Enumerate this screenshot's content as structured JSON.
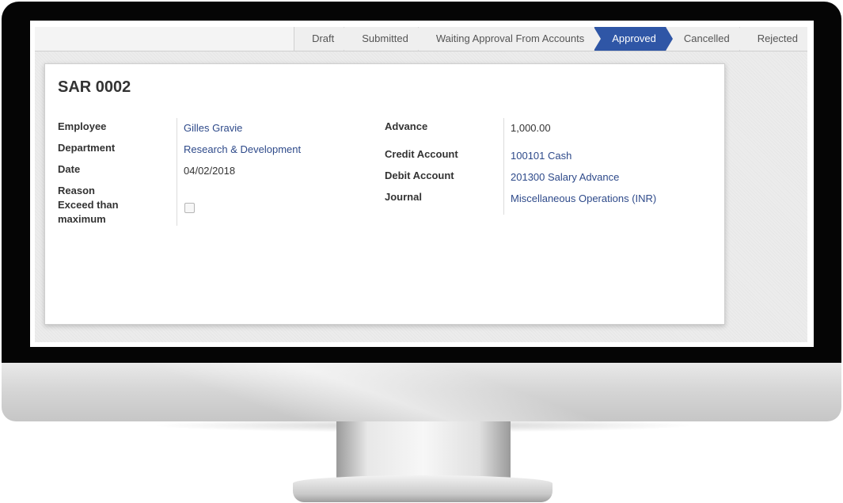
{
  "statusbar": {
    "stages": [
      "Draft",
      "Submitted",
      "Waiting Approval From Accounts",
      "Approved",
      "Cancelled",
      "Rejected"
    ],
    "active_stage": "Approved"
  },
  "record": {
    "title": "SAR 0002",
    "left_fields": {
      "employee_label": "Employee",
      "employee_value": "Gilles Gravie",
      "department_label": "Department",
      "department_value": "Research & Development",
      "date_label": "Date",
      "date_value": "04/02/2018",
      "reason_label": "Reason",
      "exceed_label": "Exceed than maximum",
      "exceed_checked": false
    },
    "right_fields": {
      "advance_label": "Advance",
      "advance_value": "1,000.00",
      "credit_label": "Credit Account",
      "credit_value": "100101 Cash",
      "debit_label": "Debit Account",
      "debit_value": "201300 Salary Advance",
      "journal_label": "Journal",
      "journal_value": "Miscellaneous Operations (INR)"
    }
  },
  "colors": {
    "active_stage": "#2f56a6",
    "link": "#2e4a8a",
    "bezel": "#050505"
  }
}
